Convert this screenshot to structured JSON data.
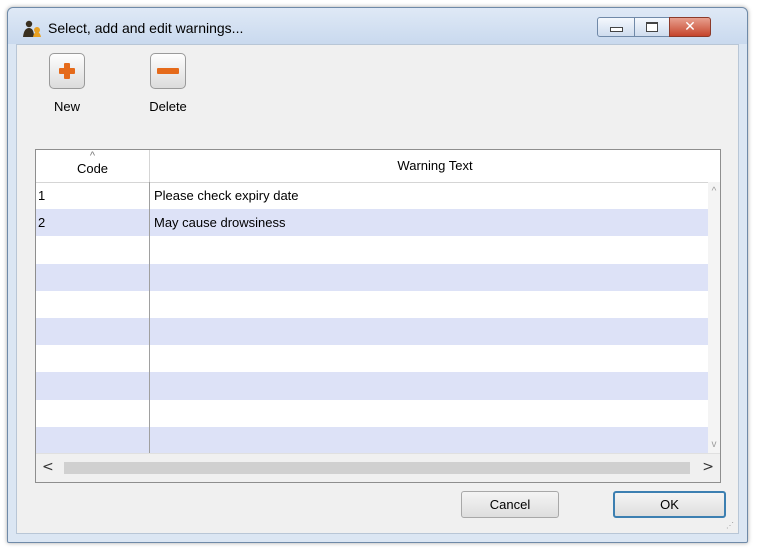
{
  "window": {
    "title": "Select, add and edit warnings...",
    "controls": {
      "minimize": "minimize",
      "maximize": "maximize",
      "close": "✕"
    }
  },
  "toolbar": {
    "new_label": "New",
    "delete_label": "Delete",
    "accent_color": "#e56a1a"
  },
  "grid": {
    "columns": [
      "Code",
      "Warning Text"
    ],
    "sorted_column": "Code",
    "sort_indicator": "^",
    "rows": [
      {
        "code": "1",
        "text": "Please check expiry date"
      },
      {
        "code": "2",
        "text": "May cause drowsiness"
      },
      {
        "code": "",
        "text": ""
      },
      {
        "code": "",
        "text": ""
      },
      {
        "code": "",
        "text": ""
      },
      {
        "code": "",
        "text": ""
      },
      {
        "code": "",
        "text": ""
      },
      {
        "code": "",
        "text": ""
      },
      {
        "code": "",
        "text": ""
      },
      {
        "code": "",
        "text": ""
      }
    ],
    "alt_row_color": "#dde2f7",
    "scroll": {
      "left": "<",
      "right": ">",
      "up": "^",
      "down": "v"
    }
  },
  "buttons": {
    "cancel_label": "Cancel",
    "ok_label": "OK"
  }
}
